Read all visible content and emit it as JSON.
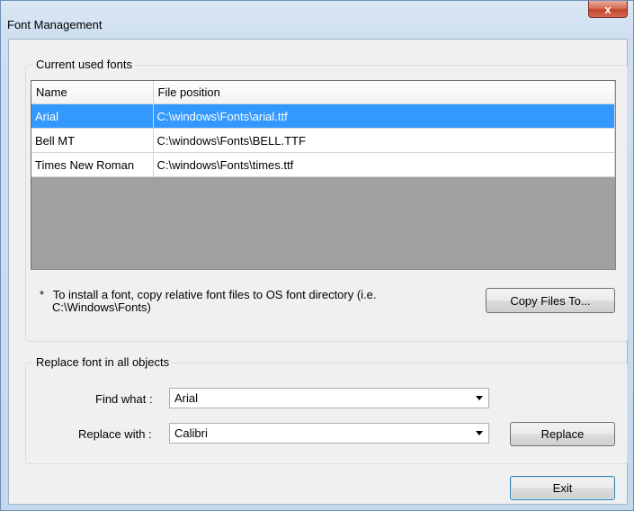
{
  "window": {
    "title": "Font Management",
    "close_glyph": "x"
  },
  "fonts_group": {
    "title": "Current used fonts",
    "columns": [
      "Name",
      "File position"
    ],
    "rows": [
      {
        "name": "Arial",
        "path": "C:\\windows\\Fonts\\arial.ttf",
        "selected": true
      },
      {
        "name": "Bell MT",
        "path": "C:\\windows\\Fonts\\BELL.TTF",
        "selected": false
      },
      {
        "name": "Times New Roman",
        "path": "C:\\windows\\Fonts\\times.ttf",
        "selected": false
      }
    ],
    "note_marker": "*",
    "note_line1": "To install a font, copy relative font files to OS font directory (i.e.",
    "note_line2": "C:\\Windows\\Fonts)",
    "copy_button": "Copy Files To..."
  },
  "replace_group": {
    "title": "Replace font in all objects",
    "find_label": "Find what :",
    "find_value": "Arial",
    "replace_label": "Replace with :",
    "replace_value": "Calibri",
    "replace_button": "Replace"
  },
  "exit_button": "Exit",
  "colors": {
    "selection": "#3399ff",
    "close": "#c2432a"
  }
}
